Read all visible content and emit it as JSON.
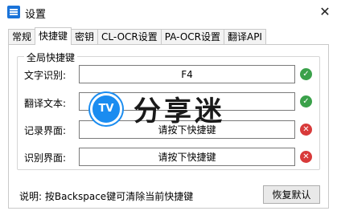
{
  "window": {
    "title": "设置",
    "close_glyph": "✕"
  },
  "tabs": [
    {
      "label": "常规",
      "active": false
    },
    {
      "label": "快捷键",
      "active": true
    },
    {
      "label": "密钥",
      "active": false
    },
    {
      "label": "CL-OCR设置",
      "active": false
    },
    {
      "label": "PA-OCR设置",
      "active": false
    },
    {
      "label": "翻译API",
      "active": false
    }
  ],
  "group": {
    "title": "全局快捷键"
  },
  "rows": [
    {
      "label": "文字识别:",
      "value": "F4",
      "status": "ok"
    },
    {
      "label": "翻译文本:",
      "value": "",
      "status": "ok"
    },
    {
      "label": "记录界面:",
      "value": "请按下快捷键",
      "status": "err"
    },
    {
      "label": "识别界面:",
      "value": "请按下快捷键",
      "status": "err"
    }
  ],
  "status_glyphs": {
    "ok": "✓",
    "err": "✕"
  },
  "colors": {
    "ok": "#3aa14a",
    "err": "#d83a3a",
    "watermark": "#1a8cf0"
  },
  "help_text": "说明: 按Backspace键可清除当前快捷键",
  "restore_button": "恢复默认",
  "watermark": {
    "badge": "TV",
    "text": "分享迷"
  }
}
